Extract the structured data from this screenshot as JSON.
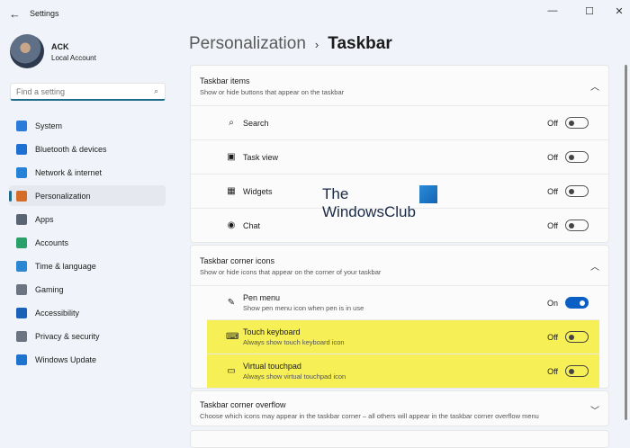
{
  "window": {
    "title": "Settings",
    "back": "←",
    "minimize": "—",
    "maximize": "☐",
    "close": "✕"
  },
  "user": {
    "name": "ACK",
    "account": "Local Account"
  },
  "search": {
    "placeholder": "Find a setting"
  },
  "nav": [
    {
      "label": "System",
      "icon": "system-icon",
      "color": "#2b7bd8"
    },
    {
      "label": "Bluetooth & devices",
      "icon": "bluetooth-icon",
      "color": "#1d6fd1"
    },
    {
      "label": "Network & internet",
      "icon": "wifi-icon",
      "color": "#2483d6"
    },
    {
      "label": "Personalization",
      "icon": "brush-icon",
      "color": "#d46d2a"
    },
    {
      "label": "Apps",
      "icon": "apps-icon",
      "color": "#5a6574"
    },
    {
      "label": "Accounts",
      "icon": "accounts-icon",
      "color": "#2aa06b"
    },
    {
      "label": "Time & language",
      "icon": "globe-icon",
      "color": "#2d86cf"
    },
    {
      "label": "Gaming",
      "icon": "gaming-icon",
      "color": "#6b7480"
    },
    {
      "label": "Accessibility",
      "icon": "accessibility-icon",
      "color": "#1a62b8"
    },
    {
      "label": "Privacy & security",
      "icon": "shield-icon",
      "color": "#6b7480"
    },
    {
      "label": "Windows Update",
      "icon": "update-icon",
      "color": "#1e73cf"
    }
  ],
  "breadcrumb": {
    "parent": "Personalization",
    "sep": "›",
    "current": "Taskbar"
  },
  "taskbar_items": {
    "title": "Taskbar items",
    "subtitle": "Show or hide buttons that appear on the taskbar",
    "rows": [
      {
        "label": "Search",
        "state": "Off",
        "icon": "⌕"
      },
      {
        "label": "Task view",
        "state": "Off",
        "icon": "▣"
      },
      {
        "label": "Widgets",
        "state": "Off",
        "icon": "▦"
      },
      {
        "label": "Chat",
        "state": "Off",
        "icon": "◉"
      }
    ]
  },
  "corner_icons": {
    "title": "Taskbar corner icons",
    "subtitle": "Show or hide icons that appear on the corner of your taskbar",
    "rows": [
      {
        "label": "Pen menu",
        "sub": "Show pen menu icon when pen is in use",
        "state": "On",
        "icon": "✎"
      },
      {
        "label": "Touch keyboard",
        "sub": "Always show touch keyboard icon",
        "state": "Off",
        "icon": "⌨"
      },
      {
        "label": "Virtual touchpad",
        "sub": "Always show virtual touchpad icon",
        "state": "Off",
        "icon": "▭"
      }
    ]
  },
  "overflow": {
    "title": "Taskbar corner overflow",
    "subtitle": "Choose which icons may appear in the taskbar corner – all others will appear in the taskbar corner overflow menu"
  },
  "watermark": {
    "line1": "The",
    "line2": "WindowsClub"
  },
  "colors": {
    "accent": "#0a5fc4",
    "highlight": "#f6ef55"
  }
}
